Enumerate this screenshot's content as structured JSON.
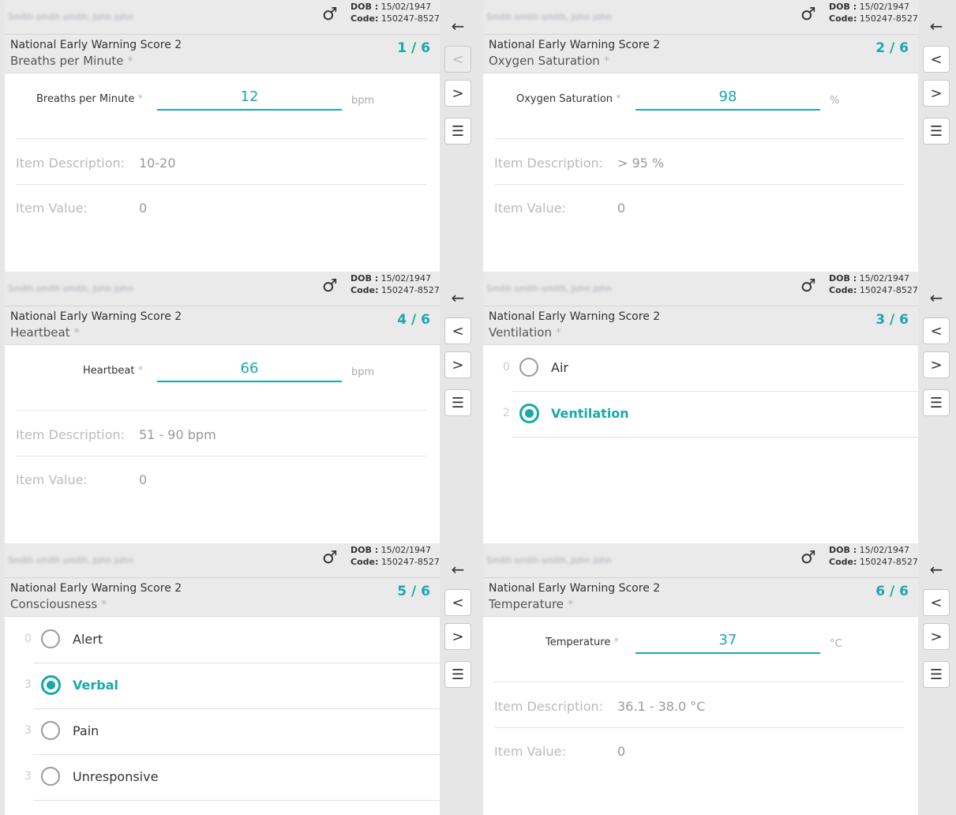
{
  "patient": {
    "name": "Smith smith smith, John john",
    "dob_label": "DOB :",
    "dob": "15/02/1947",
    "code_label": "Code:",
    "code": "150247-8527",
    "gender_symbol": "♂"
  },
  "score_title": "National Early Warning Score 2",
  "nav_icons": {
    "back": "←",
    "prev": "<",
    "next": ">",
    "list": "☰"
  },
  "info_labels": {
    "description": "Item Description:",
    "value": "Item Value:"
  },
  "panels": [
    {
      "question": "Breaths per Minute",
      "required": "*",
      "page": "1 / 6",
      "field_label": "Breaths per Minute",
      "value": "12",
      "unit": "bpm",
      "description": "10-20",
      "item_value": "0",
      "prev_disabled": true
    },
    {
      "question": "Oxygen Saturation",
      "required": "*",
      "page": "2 / 6",
      "field_label": "Oxygen Saturation",
      "value": "98",
      "unit": "%",
      "description": "> 95 %",
      "item_value": "0",
      "prev_disabled": false
    },
    {
      "question": "Heartbeat",
      "required": "*",
      "page": "4 / 6",
      "field_label": "Heartbeat",
      "value": "66",
      "unit": "bpm",
      "description": "51 - 90 bpm",
      "item_value": "0",
      "prev_disabled": false
    },
    {
      "question": "Ventilation",
      "required": "*",
      "page": "3 / 6",
      "options": [
        {
          "score": "0",
          "label": "Air",
          "selected": false
        },
        {
          "score": "2",
          "label": "Ventilation",
          "selected": true
        }
      ],
      "prev_disabled": false
    },
    {
      "question": "Consciousness",
      "required": "*",
      "page": "5 / 6",
      "options": [
        {
          "score": "0",
          "label": "Alert",
          "selected": false
        },
        {
          "score": "3",
          "label": "Verbal",
          "selected": true
        },
        {
          "score": "3",
          "label": "Pain",
          "selected": false
        },
        {
          "score": "3",
          "label": "Unresponsive",
          "selected": false
        }
      ],
      "prev_disabled": false
    },
    {
      "question": "Temperature",
      "required": "*",
      "page": "6 / 6",
      "field_label": "Temperature",
      "value": "37",
      "unit": "°C",
      "description": "36.1 - 38.0 °C",
      "item_value": "0",
      "prev_disabled": false
    }
  ],
  "colors": {
    "accent": "#1aa8a8",
    "background": "#e6e6e6"
  }
}
